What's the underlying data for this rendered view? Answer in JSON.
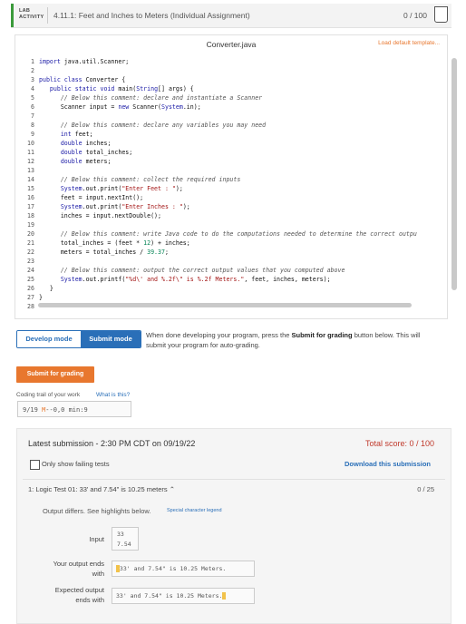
{
  "header": {
    "lab_label_line1": "LAB",
    "lab_label_line2": "ACTIVITY",
    "title": "4.11.1: Feet and Inches to Meters (Individual Assignment)",
    "score": "0 / 100"
  },
  "editor": {
    "filename": "Converter.java",
    "load_template": "Load default template...",
    "lines": [
      {
        "n": "1",
        "parts": [
          {
            "c": "kw",
            "t": "import"
          },
          {
            "c": "tx",
            "t": " java.util.Scanner;"
          }
        ]
      },
      {
        "n": "2",
        "parts": []
      },
      {
        "n": "3",
        "parts": [
          {
            "c": "kw",
            "t": "public class"
          },
          {
            "c": "tx",
            "t": " Converter {"
          }
        ]
      },
      {
        "n": "4",
        "parts": [
          {
            "c": "tx",
            "t": "   "
          },
          {
            "c": "kw",
            "t": "public static void"
          },
          {
            "c": "tx",
            "t": " main("
          },
          {
            "c": "kw",
            "t": "String"
          },
          {
            "c": "tx",
            "t": "[] args) {"
          }
        ]
      },
      {
        "n": "5",
        "parts": [
          {
            "c": "tx",
            "t": "      "
          },
          {
            "c": "cm",
            "t": "// Below this comment: declare and instantiate a Scanner"
          }
        ]
      },
      {
        "n": "6",
        "parts": [
          {
            "c": "tx",
            "t": "      Scanner input = "
          },
          {
            "c": "kw",
            "t": "new"
          },
          {
            "c": "tx",
            "t": " Scanner("
          },
          {
            "c": "kw",
            "t": "System"
          },
          {
            "c": "tx",
            "t": ".in);"
          }
        ]
      },
      {
        "n": "7",
        "parts": []
      },
      {
        "n": "8",
        "parts": [
          {
            "c": "tx",
            "t": "      "
          },
          {
            "c": "cm",
            "t": "// Below this comment: declare any variables you may need"
          }
        ]
      },
      {
        "n": "9",
        "parts": [
          {
            "c": "tx",
            "t": "      "
          },
          {
            "c": "kw",
            "t": "int"
          },
          {
            "c": "tx",
            "t": " feet;"
          }
        ]
      },
      {
        "n": "10",
        "parts": [
          {
            "c": "tx",
            "t": "      "
          },
          {
            "c": "kw",
            "t": "double"
          },
          {
            "c": "tx",
            "t": " inches;"
          }
        ]
      },
      {
        "n": "11",
        "parts": [
          {
            "c": "tx",
            "t": "      "
          },
          {
            "c": "kw",
            "t": "double"
          },
          {
            "c": "tx",
            "t": " total_inches;"
          }
        ]
      },
      {
        "n": "12",
        "parts": [
          {
            "c": "tx",
            "t": "      "
          },
          {
            "c": "kw",
            "t": "double"
          },
          {
            "c": "tx",
            "t": " meters;"
          }
        ]
      },
      {
        "n": "13",
        "parts": []
      },
      {
        "n": "14",
        "parts": [
          {
            "c": "tx",
            "t": "      "
          },
          {
            "c": "cm",
            "t": "// Below this comment: collect the required inputs"
          }
        ]
      },
      {
        "n": "15",
        "parts": [
          {
            "c": "tx",
            "t": "      "
          },
          {
            "c": "kw",
            "t": "System"
          },
          {
            "c": "tx",
            "t": ".out.print("
          },
          {
            "c": "st",
            "t": "\"Enter Feet : \""
          },
          {
            "c": "tx",
            "t": ");"
          }
        ]
      },
      {
        "n": "16",
        "parts": [
          {
            "c": "tx",
            "t": "      feet = input.nextInt();"
          }
        ]
      },
      {
        "n": "17",
        "parts": [
          {
            "c": "tx",
            "t": "      "
          },
          {
            "c": "kw",
            "t": "System"
          },
          {
            "c": "tx",
            "t": ".out.print("
          },
          {
            "c": "st",
            "t": "\"Enter Inches : \""
          },
          {
            "c": "tx",
            "t": ");"
          }
        ]
      },
      {
        "n": "18",
        "parts": [
          {
            "c": "tx",
            "t": "      inches = input.nextDouble();"
          }
        ]
      },
      {
        "n": "19",
        "parts": []
      },
      {
        "n": "20",
        "parts": [
          {
            "c": "tx",
            "t": "      "
          },
          {
            "c": "cm",
            "t": "// Below this comment: write Java code to do the computations needed to determine the correct outpu"
          }
        ]
      },
      {
        "n": "21",
        "parts": [
          {
            "c": "tx",
            "t": "      total_inches = (feet * "
          },
          {
            "c": "nm",
            "t": "12"
          },
          {
            "c": "tx",
            "t": ") + inches;"
          }
        ]
      },
      {
        "n": "22",
        "parts": [
          {
            "c": "tx",
            "t": "      meters = total_inches / "
          },
          {
            "c": "nm",
            "t": "39.37"
          },
          {
            "c": "tx",
            "t": ";"
          }
        ]
      },
      {
        "n": "23",
        "parts": []
      },
      {
        "n": "24",
        "parts": [
          {
            "c": "tx",
            "t": "      "
          },
          {
            "c": "cm",
            "t": "// Below this comment: output the correct output values that you computed above"
          }
        ]
      },
      {
        "n": "25",
        "parts": [
          {
            "c": "tx",
            "t": "      "
          },
          {
            "c": "kw",
            "t": "System"
          },
          {
            "c": "tx",
            "t": ".out.printf("
          },
          {
            "c": "st",
            "t": "\"%d\\' and %.2f\\\" is %.2f Meters.\""
          },
          {
            "c": "tx",
            "t": ", feet, inches, meters);"
          }
        ]
      },
      {
        "n": "26",
        "parts": [
          {
            "c": "tx",
            "t": "   }"
          }
        ]
      },
      {
        "n": "27",
        "parts": [
          {
            "c": "tx",
            "t": "}"
          }
        ]
      },
      {
        "n": "28",
        "parts": []
      }
    ]
  },
  "modes": {
    "develop": "Develop mode",
    "submit": "Submit mode",
    "help_pre": "When done developing your program, press the ",
    "help_bold": "Submit for grading",
    "help_post": " button below. This will submit your program for auto-grading."
  },
  "submit_button": "Submit for grading",
  "coding_trail": {
    "label": "Coding trail of your work",
    "help": "What is this?",
    "value_prefix": "9/19 ",
    "value_mark": "M",
    "value_suffix": "--0,0 min:9"
  },
  "submission": {
    "latest": "Latest submission - 2:30 PM CDT on 09/19/22",
    "total_score": "Total score: 0 / 100",
    "only_failing": "Only show failing tests",
    "download": "Download this submission",
    "test_title": "1: Logic Test 01: 33' and 7.54\" is 10.25 meters",
    "test_score": "0 / 25",
    "output_differs": "Output differs. See highlights below.",
    "legend": "Special character legend",
    "input_label": "Input",
    "input_lines": [
      "33",
      "7.54"
    ],
    "your_label_line1": "Your output ends",
    "your_label_line2": "with",
    "your_output": "33' and 7.54\" is 10.25 Meters.",
    "expected_label_line1": "Expected output",
    "expected_label_line2": "ends with",
    "expected_output": "33' and 7.54\" is 10.25 Meters."
  }
}
